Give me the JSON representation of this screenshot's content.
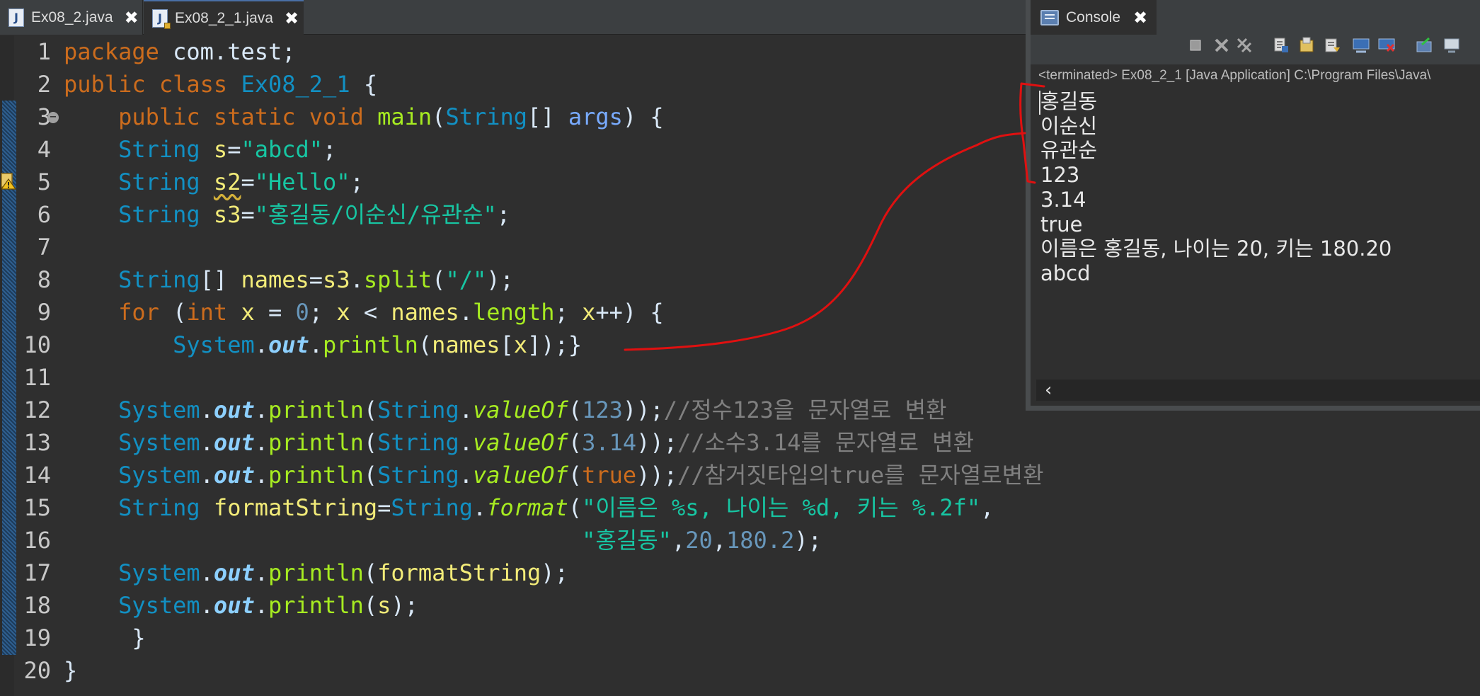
{
  "editor_tabs": [
    {
      "title": "Ex08_2.java"
    },
    {
      "title": "Ex08_2_1.java"
    }
  ],
  "gutter": {
    "line_numbers": [
      "1",
      "2",
      "3",
      "4",
      "5",
      "6",
      "7",
      "8",
      "9",
      "10",
      "11",
      "12",
      "13",
      "14",
      "15",
      "16",
      "17",
      "18",
      "19",
      "20"
    ],
    "fold_marker": "−"
  },
  "code_lines": [
    [
      {
        "t": "package",
        "c": "kw"
      },
      {
        "t": " com.test;",
        "c": "pl"
      }
    ],
    [
      {
        "t": "public",
        "c": "kw"
      },
      {
        "t": " ",
        "c": "pl"
      },
      {
        "t": "class",
        "c": "kw"
      },
      {
        "t": " ",
        "c": "pl"
      },
      {
        "t": "Ex08_2_1",
        "c": "cls"
      },
      {
        "t": " {",
        "c": "pl"
      }
    ],
    [
      {
        "t": "    ",
        "c": "pl"
      },
      {
        "t": "public",
        "c": "kw"
      },
      {
        "t": " ",
        "c": "pl"
      },
      {
        "t": "static",
        "c": "kw"
      },
      {
        "t": " ",
        "c": "pl"
      },
      {
        "t": "void",
        "c": "kw"
      },
      {
        "t": " ",
        "c": "pl"
      },
      {
        "t": "main",
        "c": "meth"
      },
      {
        "t": "(",
        "c": "pl"
      },
      {
        "t": "String",
        "c": "ty"
      },
      {
        "t": "[] ",
        "c": "pl"
      },
      {
        "t": "args",
        "c": "arg"
      },
      {
        "t": ") {",
        "c": "pl"
      }
    ],
    [
      {
        "t": "    ",
        "c": "pl"
      },
      {
        "t": "String",
        "c": "ty"
      },
      {
        "t": " ",
        "c": "pl"
      },
      {
        "t": "s",
        "c": "var"
      },
      {
        "t": "=",
        "c": "pl"
      },
      {
        "t": "\"abcd\"",
        "c": "str"
      },
      {
        "t": ";",
        "c": "pl"
      }
    ],
    [
      {
        "t": "    ",
        "c": "pl"
      },
      {
        "t": "String",
        "c": "ty"
      },
      {
        "t": " ",
        "c": "pl"
      },
      {
        "t": "s2",
        "c": "var",
        "w": true
      },
      {
        "t": "=",
        "c": "pl"
      },
      {
        "t": "\"Hello\"",
        "c": "str"
      },
      {
        "t": ";",
        "c": "pl"
      }
    ],
    [
      {
        "t": "    ",
        "c": "pl"
      },
      {
        "t": "String",
        "c": "ty"
      },
      {
        "t": " ",
        "c": "pl"
      },
      {
        "t": "s3",
        "c": "var"
      },
      {
        "t": "=",
        "c": "pl"
      },
      {
        "t": "\"홍길동/이순신/유관순\"",
        "c": "str"
      },
      {
        "t": ";",
        "c": "pl"
      }
    ],
    [],
    [
      {
        "t": "    ",
        "c": "pl"
      },
      {
        "t": "String",
        "c": "ty"
      },
      {
        "t": "[] ",
        "c": "pl"
      },
      {
        "t": "names",
        "c": "var"
      },
      {
        "t": "=",
        "c": "pl"
      },
      {
        "t": "s3",
        "c": "var"
      },
      {
        "t": ".",
        "c": "pl"
      },
      {
        "t": "split",
        "c": "meth"
      },
      {
        "t": "(",
        "c": "pl"
      },
      {
        "t": "\"/\"",
        "c": "str"
      },
      {
        "t": ");",
        "c": "pl"
      }
    ],
    [
      {
        "t": "    ",
        "c": "pl"
      },
      {
        "t": "for",
        "c": "kw"
      },
      {
        "t": " (",
        "c": "pl"
      },
      {
        "t": "int",
        "c": "kw"
      },
      {
        "t": " ",
        "c": "pl"
      },
      {
        "t": "x",
        "c": "var"
      },
      {
        "t": " = ",
        "c": "pl"
      },
      {
        "t": "0",
        "c": "num"
      },
      {
        "t": "; ",
        "c": "pl"
      },
      {
        "t": "x",
        "c": "var"
      },
      {
        "t": " < ",
        "c": "pl"
      },
      {
        "t": "names",
        "c": "var"
      },
      {
        "t": ".",
        "c": "pl"
      },
      {
        "t": "length",
        "c": "meth"
      },
      {
        "t": "; ",
        "c": "pl"
      },
      {
        "t": "x",
        "c": "var"
      },
      {
        "t": "++) {",
        "c": "pl"
      }
    ],
    [
      {
        "t": "        ",
        "c": "pl"
      },
      {
        "t": "System",
        "c": "cls"
      },
      {
        "t": ".",
        "c": "pl"
      },
      {
        "t": "out",
        "c": "fld"
      },
      {
        "t": ".",
        "c": "pl"
      },
      {
        "t": "println",
        "c": "meth"
      },
      {
        "t": "(",
        "c": "pl"
      },
      {
        "t": "names",
        "c": "var"
      },
      {
        "t": "[",
        "c": "pl"
      },
      {
        "t": "x",
        "c": "var"
      },
      {
        "t": "]);}",
        "c": "pl"
      }
    ],
    [],
    [
      {
        "t": "    ",
        "c": "pl"
      },
      {
        "t": "System",
        "c": "cls"
      },
      {
        "t": ".",
        "c": "pl"
      },
      {
        "t": "out",
        "c": "fld"
      },
      {
        "t": ".",
        "c": "pl"
      },
      {
        "t": "println",
        "c": "meth"
      },
      {
        "t": "(",
        "c": "pl"
      },
      {
        "t": "String",
        "c": "cls"
      },
      {
        "t": ".",
        "c": "pl"
      },
      {
        "t": "valueOf",
        "c": "stm"
      },
      {
        "t": "(",
        "c": "pl"
      },
      {
        "t": "123",
        "c": "num"
      },
      {
        "t": "));",
        "c": "pl"
      },
      {
        "t": "//정수123을 문자열로 변환",
        "c": "cmt"
      }
    ],
    [
      {
        "t": "    ",
        "c": "pl"
      },
      {
        "t": "System",
        "c": "cls"
      },
      {
        "t": ".",
        "c": "pl"
      },
      {
        "t": "out",
        "c": "fld"
      },
      {
        "t": ".",
        "c": "pl"
      },
      {
        "t": "println",
        "c": "meth"
      },
      {
        "t": "(",
        "c": "pl"
      },
      {
        "t": "String",
        "c": "cls"
      },
      {
        "t": ".",
        "c": "pl"
      },
      {
        "t": "valueOf",
        "c": "stm"
      },
      {
        "t": "(",
        "c": "pl"
      },
      {
        "t": "3.14",
        "c": "num"
      },
      {
        "t": "));",
        "c": "pl"
      },
      {
        "t": "//소수3.14를 문자열로 변환",
        "c": "cmt"
      }
    ],
    [
      {
        "t": "    ",
        "c": "pl"
      },
      {
        "t": "System",
        "c": "cls"
      },
      {
        "t": ".",
        "c": "pl"
      },
      {
        "t": "out",
        "c": "fld"
      },
      {
        "t": ".",
        "c": "pl"
      },
      {
        "t": "println",
        "c": "meth"
      },
      {
        "t": "(",
        "c": "pl"
      },
      {
        "t": "String",
        "c": "cls"
      },
      {
        "t": ".",
        "c": "pl"
      },
      {
        "t": "valueOf",
        "c": "stm"
      },
      {
        "t": "(",
        "c": "pl"
      },
      {
        "t": "true",
        "c": "kw"
      },
      {
        "t": "));",
        "c": "pl"
      },
      {
        "t": "//참거짓타입의true를 문자열로변환",
        "c": "cmt"
      }
    ],
    [
      {
        "t": "    ",
        "c": "pl"
      },
      {
        "t": "String",
        "c": "ty"
      },
      {
        "t": " ",
        "c": "pl"
      },
      {
        "t": "formatString",
        "c": "var"
      },
      {
        "t": "=",
        "c": "pl"
      },
      {
        "t": "String",
        "c": "cls"
      },
      {
        "t": ".",
        "c": "pl"
      },
      {
        "t": "format",
        "c": "stm"
      },
      {
        "t": "(",
        "c": "pl"
      },
      {
        "t": "\"이름은 %s, 나이는 %d, 키는 %.2f\"",
        "c": "str"
      },
      {
        "t": ",",
        "c": "pl"
      }
    ],
    [
      {
        "t": "                                      ",
        "c": "pl"
      },
      {
        "t": "\"홍길동\"",
        "c": "str"
      },
      {
        "t": ",",
        "c": "pl"
      },
      {
        "t": "20",
        "c": "num"
      },
      {
        "t": ",",
        "c": "pl"
      },
      {
        "t": "180.2",
        "c": "num"
      },
      {
        "t": ");",
        "c": "pl"
      }
    ],
    [
      {
        "t": "    ",
        "c": "pl"
      },
      {
        "t": "System",
        "c": "cls"
      },
      {
        "t": ".",
        "c": "pl"
      },
      {
        "t": "out",
        "c": "fld"
      },
      {
        "t": ".",
        "c": "pl"
      },
      {
        "t": "println",
        "c": "meth"
      },
      {
        "t": "(",
        "c": "pl"
      },
      {
        "t": "formatString",
        "c": "var"
      },
      {
        "t": ");",
        "c": "pl"
      }
    ],
    [
      {
        "t": "    ",
        "c": "pl"
      },
      {
        "t": "System",
        "c": "cls"
      },
      {
        "t": ".",
        "c": "pl"
      },
      {
        "t": "out",
        "c": "fld"
      },
      {
        "t": ".",
        "c": "pl"
      },
      {
        "t": "println",
        "c": "meth"
      },
      {
        "t": "(",
        "c": "pl"
      },
      {
        "t": "s",
        "c": "var"
      },
      {
        "t": ");",
        "c": "pl"
      }
    ],
    [
      {
        "t": "     }",
        "c": "pl"
      }
    ],
    [
      {
        "t": "}",
        "c": "pl"
      }
    ]
  ],
  "console": {
    "tab_title": "Console",
    "status": "<terminated> Ex08_2_1 [Java Application] C:\\Program Files\\Java\\",
    "output_lines": [
      "홍길동",
      "이순신",
      "유관순",
      "123",
      "3.14",
      "true",
      "이름은 홍길동,  나이는 20,  키는 180.20",
      "abcd"
    ],
    "hscroll_arrow": "‹",
    "toolbar_icons": [
      "terminate-icon",
      "remove-launch-icon",
      "remove-all-terminated-icon",
      "scroll-lock-icon",
      "word-wrap-icon",
      "show-on-output-icon",
      "show-on-error-icon",
      "pin-console-icon",
      "open-console-icon",
      "display-selected-console-icon"
    ]
  },
  "close_glyph": "✖",
  "colors": {
    "annotation": "#e01010",
    "keyword": "#cc6c1d",
    "type": "#1290c3",
    "string": "#17c6a3",
    "variable": "#f3ec79",
    "method": "#a7ec21"
  }
}
